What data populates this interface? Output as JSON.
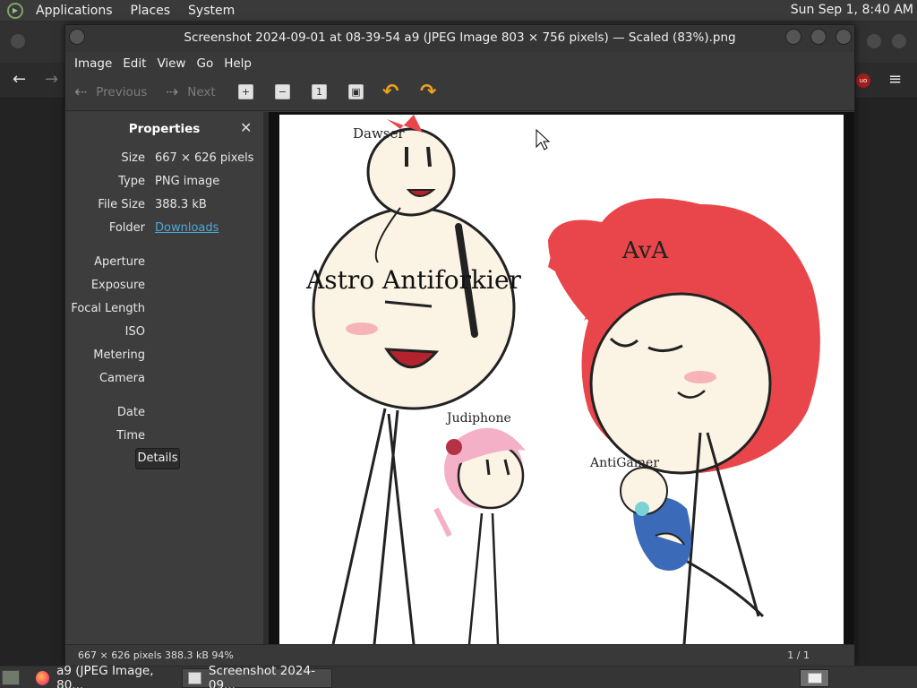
{
  "top_panel": {
    "menus": [
      "Applications",
      "Places",
      "System"
    ],
    "clock": "Sun Sep  1,  8:40 AM"
  },
  "window": {
    "title": "Screenshot 2024-09-01 at 08-39-54 a9 (JPEG Image 803 × 756 pixels) — Scaled (83%).png",
    "menu": [
      "Image",
      "Edit",
      "View",
      "Go",
      "Help"
    ],
    "toolbar": {
      "previous": "Previous",
      "next": "Next"
    }
  },
  "sidebar": {
    "title": "Properties",
    "properties": [
      {
        "key": "Size",
        "value": "667 × 626 pixels"
      },
      {
        "key": "Type",
        "value": "PNG image"
      },
      {
        "key": "File Size",
        "value": "388.3 kB"
      },
      {
        "key": "Folder",
        "value": "Downloads"
      },
      {
        "key": "Aperture",
        "value": ""
      },
      {
        "key": "Exposure",
        "value": ""
      },
      {
        "key": "Focal Length",
        "value": ""
      },
      {
        "key": "ISO",
        "value": ""
      },
      {
        "key": "Metering",
        "value": ""
      },
      {
        "key": "Camera",
        "value": ""
      },
      {
        "key": "Date",
        "value": ""
      },
      {
        "key": "Time",
        "value": ""
      }
    ],
    "details_label": "Details"
  },
  "image_labels": {
    "dawser": "Dawser",
    "astro": "Astro Antiforkier",
    "ava": "AvA",
    "judiphone": "Judiphone",
    "antigamer": "AntiGamer"
  },
  "statusbar": {
    "info": "667 × 626 pixels  388.3 kB   94%",
    "page": "1 / 1"
  },
  "taskbar": {
    "tasks": [
      "a9 (JPEG Image, 80...",
      "Screenshot 2024-09..."
    ]
  },
  "colors": {
    "link": "#4ea7d6",
    "hair_red": "#e8464a",
    "rotate_icon": "#f0a020"
  }
}
